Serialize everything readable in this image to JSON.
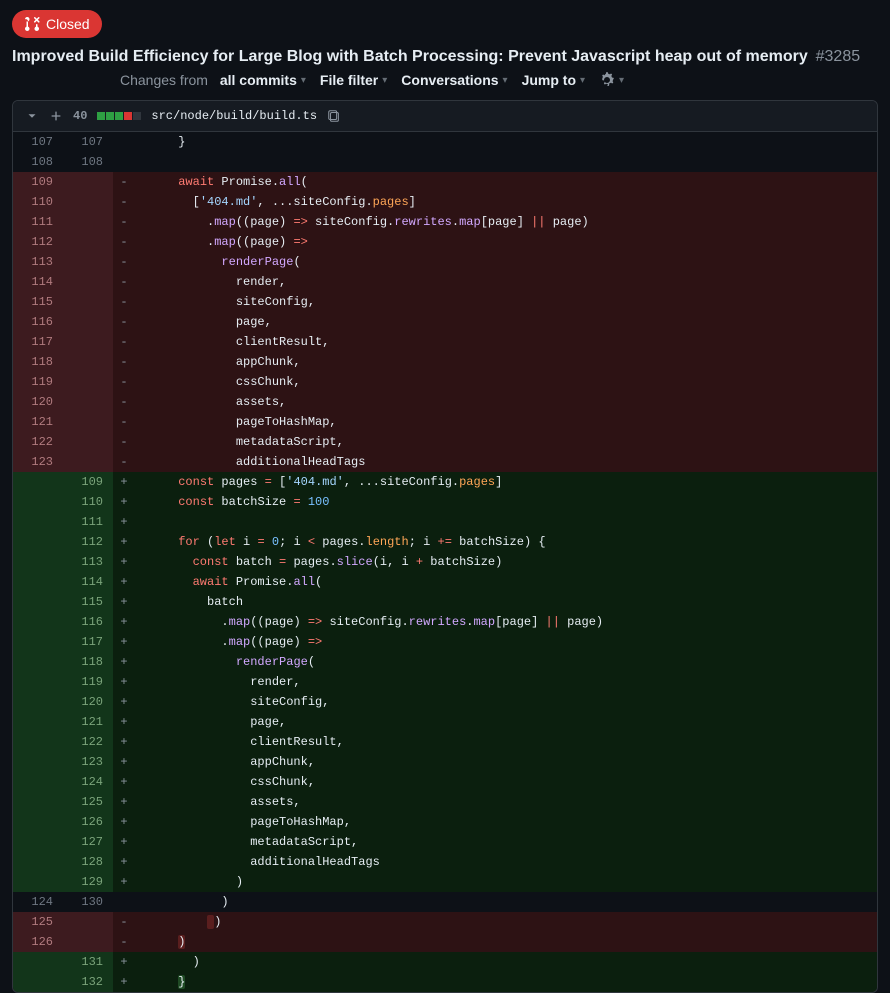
{
  "header": {
    "status_label": "Closed",
    "title": "Improved Build Efficiency for Large Blog with Batch Processing: Prevent Javascript heap out of memory",
    "number": "#3285"
  },
  "toolbar": {
    "changes_from_prefix": "Changes from",
    "changes_from_value": "all commits",
    "file_filter": "File filter",
    "conversations": "Conversations",
    "jump_to": "Jump to"
  },
  "file": {
    "diff_count": "40",
    "path": "src/node/build/build.ts"
  },
  "lines": [
    {
      "type": "ctx",
      "old": "107",
      "new": "107",
      "html": "      }"
    },
    {
      "type": "ctx",
      "old": "108",
      "new": "108",
      "html": ""
    },
    {
      "type": "del",
      "old": "109",
      "new": "",
      "html": "      <span class='k'>await</span> Promise.<span class='f'>all</span>("
    },
    {
      "type": "del",
      "old": "110",
      "new": "",
      "html": "        [<span class='s'>'404.md'</span>, ...siteConfig.<span class='p'>pages</span>]"
    },
    {
      "type": "del",
      "old": "111",
      "new": "",
      "html": "          .<span class='f'>map</span>((page) <span class='o'>=&gt;</span> siteConfig.<span class='f'>rewrites</span>.<span class='f'>map</span>[page] <span class='o'>||</span> page)"
    },
    {
      "type": "del",
      "old": "112",
      "new": "",
      "html": "          .<span class='f'>map</span>((page) <span class='o'>=&gt;</span>"
    },
    {
      "type": "del",
      "old": "113",
      "new": "",
      "html": "            <span class='f'>renderPage</span>("
    },
    {
      "type": "del",
      "old": "114",
      "new": "",
      "html": "              render,"
    },
    {
      "type": "del",
      "old": "115",
      "new": "",
      "html": "              siteConfig,"
    },
    {
      "type": "del",
      "old": "116",
      "new": "",
      "html": "              page,"
    },
    {
      "type": "del",
      "old": "117",
      "new": "",
      "html": "              clientResult,"
    },
    {
      "type": "del",
      "old": "118",
      "new": "",
      "html": "              appChunk,"
    },
    {
      "type": "del",
      "old": "119",
      "new": "",
      "html": "              cssChunk,"
    },
    {
      "type": "del",
      "old": "120",
      "new": "",
      "html": "              assets,"
    },
    {
      "type": "del",
      "old": "121",
      "new": "",
      "html": "              pageToHashMap,"
    },
    {
      "type": "del",
      "old": "122",
      "new": "",
      "html": "              metadataScript,"
    },
    {
      "type": "del",
      "old": "123",
      "new": "",
      "html": "              additionalHeadTags"
    },
    {
      "type": "add",
      "old": "",
      "new": "109",
      "html": "      <span class='k'>const</span> pages <span class='o'>=</span> [<span class='s'>'404.md'</span>, ...siteConfig.<span class='p'>pages</span>]"
    },
    {
      "type": "add",
      "old": "",
      "new": "110",
      "html": "      <span class='k'>const</span> batchSize <span class='o'>=</span> <span class='n'>100</span>"
    },
    {
      "type": "add",
      "old": "",
      "new": "111",
      "html": ""
    },
    {
      "type": "add",
      "old": "",
      "new": "112",
      "html": "      <span class='k'>for</span> (<span class='k'>let</span> i <span class='o'>=</span> <span class='n'>0</span>; i <span class='o'>&lt;</span> pages.<span class='p'>length</span>; i <span class='o'>+=</span> batchSize) {"
    },
    {
      "type": "add",
      "old": "",
      "new": "113",
      "html": "        <span class='k'>const</span> batch <span class='o'>=</span> pages.<span class='f'>slice</span>(i, i <span class='o'>+</span> batchSize)"
    },
    {
      "type": "add",
      "old": "",
      "new": "114",
      "html": "        <span class='k'>await</span> Promise.<span class='f'>all</span>("
    },
    {
      "type": "add",
      "old": "",
      "new": "115",
      "html": "          batch"
    },
    {
      "type": "add",
      "old": "",
      "new": "116",
      "html": "            .<span class='f'>map</span>((page) <span class='o'>=&gt;</span> siteConfig.<span class='f'>rewrites</span>.<span class='f'>map</span>[page] <span class='o'>||</span> page)"
    },
    {
      "type": "add",
      "old": "",
      "new": "117",
      "html": "            .<span class='f'>map</span>((page) <span class='o'>=&gt;</span>"
    },
    {
      "type": "add",
      "old": "",
      "new": "118",
      "html": "              <span class='f'>renderPage</span>("
    },
    {
      "type": "add",
      "old": "",
      "new": "119",
      "html": "                render,"
    },
    {
      "type": "add",
      "old": "",
      "new": "120",
      "html": "                siteConfig,"
    },
    {
      "type": "add",
      "old": "",
      "new": "121",
      "html": "                page,"
    },
    {
      "type": "add",
      "old": "",
      "new": "122",
      "html": "                clientResult,"
    },
    {
      "type": "add",
      "old": "",
      "new": "123",
      "html": "                appChunk,"
    },
    {
      "type": "add",
      "old": "",
      "new": "124",
      "html": "                cssChunk,"
    },
    {
      "type": "add",
      "old": "",
      "new": "125",
      "html": "                assets,"
    },
    {
      "type": "add",
      "old": "",
      "new": "126",
      "html": "                pageToHashMap,"
    },
    {
      "type": "add",
      "old": "",
      "new": "127",
      "html": "                metadataScript,"
    },
    {
      "type": "add",
      "old": "",
      "new": "128",
      "html": "                additionalHeadTags"
    },
    {
      "type": "add",
      "old": "",
      "new": "129",
      "html": "              )"
    },
    {
      "type": "ctx",
      "old": "124",
      "new": "130",
      "html": "            )"
    },
    {
      "type": "del",
      "old": "125",
      "new": "",
      "html": "          <span class='hl-del'> </span>)"
    },
    {
      "type": "del",
      "old": "126",
      "new": "",
      "html": "      <span class='hl-del'>)</span>"
    },
    {
      "type": "add",
      "old": "",
      "new": "131",
      "html": "        )"
    },
    {
      "type": "add",
      "old": "",
      "new": "132",
      "html": "      <span class='hl-add'>}</span>"
    }
  ]
}
